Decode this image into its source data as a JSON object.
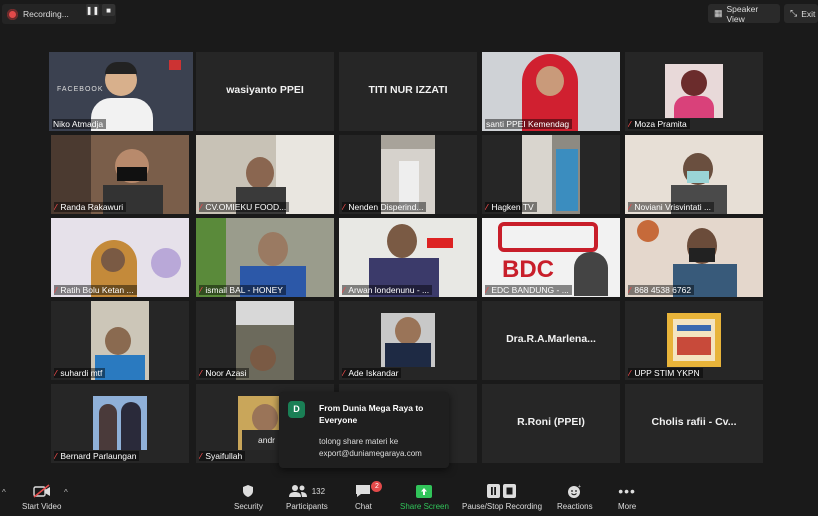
{
  "recording": {
    "label": "Recording..."
  },
  "top_right": {
    "speaker_view": "Speaker View",
    "exit": "Exit"
  },
  "participants": [
    {
      "name": "Niko Atmadja",
      "center": "",
      "video": "niko"
    },
    {
      "name": "",
      "center": "wasiyanto PPEI",
      "video": ""
    },
    {
      "name": "",
      "center": "TITI NUR IZZATI",
      "video": ""
    },
    {
      "name": "santi PPEI Kemendag",
      "center": "",
      "video": "santi"
    },
    {
      "name": "Moza Pramita",
      "center": "",
      "video": "moza"
    },
    {
      "name": "Randa Rakawuri",
      "center": "",
      "video": "randa"
    },
    {
      "name": "CV.OMIEKU FOOD...",
      "center": "",
      "video": "omieku"
    },
    {
      "name": "Nenden Disperind...",
      "center": "",
      "video": "nenden"
    },
    {
      "name": "Hagken TV",
      "center": "",
      "video": "hagken"
    },
    {
      "name": "Noviani Vrisvintati ...",
      "center": "",
      "video": "noviani"
    },
    {
      "name": "Ratih Bolu Ketan ...",
      "center": "",
      "video": "ratih"
    },
    {
      "name": "ismail BAL - HONEY",
      "center": "",
      "video": "ismail"
    },
    {
      "name": "Arwan londenunu - ...",
      "center": "",
      "video": "arwan"
    },
    {
      "name": "EDC BANDUNG - ...",
      "center": "",
      "video": "edc"
    },
    {
      "name": "868 4538 6762",
      "center": "",
      "video": "number"
    },
    {
      "name": "suhardi mtf",
      "center": "",
      "video": "suhardi"
    },
    {
      "name": "Noor Azasi",
      "center": "",
      "video": "noor"
    },
    {
      "name": "Ade Iskandar",
      "center": "",
      "video": "ade"
    },
    {
      "name": "",
      "center": "Dra.R.A.Marlena...",
      "video": ""
    },
    {
      "name": "UPP STIM YKPN",
      "center": "",
      "video": "upp"
    },
    {
      "name": "Bernard Parlaungan",
      "center": "",
      "video": "bernard"
    },
    {
      "name": "Syaifullah",
      "center": "andr",
      "video": "syaifullah"
    },
    {
      "name": "",
      "center": "",
      "video": ""
    },
    {
      "name": "",
      "center": "R.Roni (PPEI)",
      "video": ""
    },
    {
      "name": "",
      "center": "Cholis rafii - Cv...",
      "video": ""
    }
  ],
  "chat_popup": {
    "avatar_letter": "D",
    "from": "From Dunia Mega Raya to Everyone",
    "message": "tolong share materi ke export@duniamegaraya.com"
  },
  "toolbar": {
    "start_video": "Start Video",
    "security": "Security",
    "participants": "Participants",
    "participants_count": "132",
    "chat": "Chat",
    "chat_badge": "2",
    "share_screen": "Share Screen",
    "pause_stop_recording": "Pause/Stop Recording",
    "reactions": "Reactions",
    "more": "More"
  }
}
